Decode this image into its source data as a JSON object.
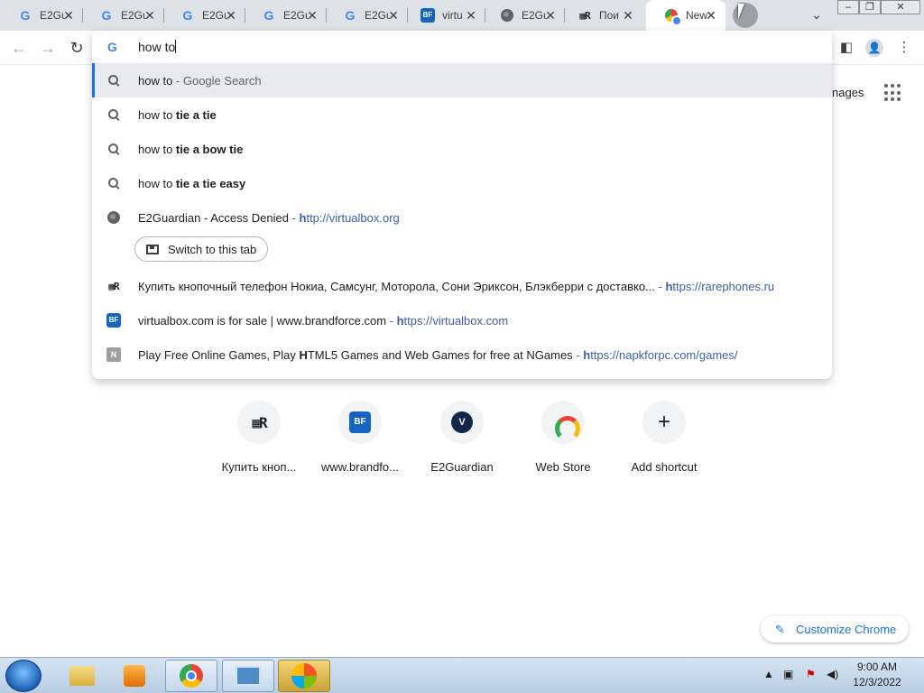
{
  "tabs": [
    {
      "title": "E2Gu",
      "favicon": "google-icon",
      "active": false
    },
    {
      "title": "E2Gu",
      "favicon": "google-icon",
      "active": false
    },
    {
      "title": "E2Gu",
      "favicon": "google-icon",
      "active": false
    },
    {
      "title": "E2Gu",
      "favicon": "google-icon",
      "active": false
    },
    {
      "title": "E2Gu",
      "favicon": "google-icon",
      "active": false
    },
    {
      "title": "virtu",
      "favicon": "brandforce-icon",
      "active": false
    },
    {
      "title": "E2Gu",
      "favicon": "globe-icon",
      "active": false
    },
    {
      "title": "Пои",
      "favicon": "rarephones-icon",
      "active": false
    },
    {
      "title": "New",
      "favicon": "chrome-icon",
      "active": true
    }
  ],
  "window_controls": {
    "minimize": "–",
    "restore": "❐",
    "close": "✕"
  },
  "omnibox": {
    "typed_text": "how to"
  },
  "suggestions": [
    {
      "icon": "search-icon",
      "plain": "how to",
      "bold": "",
      "suffix": " - Google Search"
    },
    {
      "icon": "search-icon",
      "plain": "how to ",
      "bold": "tie a tie",
      "suffix": ""
    },
    {
      "icon": "search-icon",
      "plain": "how to ",
      "bold": "tie a bow tie",
      "suffix": ""
    },
    {
      "icon": "search-icon",
      "plain": "how to ",
      "bold": "tie a tie easy",
      "suffix": ""
    }
  ],
  "history": [
    {
      "title": "E2Guardian - Access Denied",
      "url_bold": "h",
      "url_rest": "ttp://virtualbox.org"
    },
    {
      "title": "Купить кнопочный телефон Нокиа, Самсунг, Моторола, Сони Эриксон, Блэкберри с доставко...",
      "url_bold": "h",
      "url_rest": "ttps://rarephones.ru"
    },
    {
      "title": "virtualbox.com is for sale | www.brandforce.com",
      "url_bold": "h",
      "url_rest": "ttps://virtualbox.com"
    },
    {
      "title_pre": "Play Free Online Games, Play ",
      "title_bold": "H",
      "title_post": "TML5 Games and Web Games for free at NGames",
      "url_bold": "h",
      "url_rest": "ttps://napkforpc.com/games/"
    }
  ],
  "switch_tab_label": "Switch to this tab",
  "separator": " - ",
  "header": {
    "images_label": "nages"
  },
  "shortcuts": [
    {
      "label": "Купить кноп...",
      "icon": "rarephones-icon"
    },
    {
      "label": "www.brandfo...",
      "icon": "brandforce-icon"
    },
    {
      "label": "E2Guardian",
      "icon": "v-logo-icon"
    },
    {
      "label": "Web Store",
      "icon": "webstore-icon"
    },
    {
      "label": "Add shortcut",
      "icon": "plus-icon"
    }
  ],
  "customize_label": "Customize Chrome",
  "taskbar": {
    "time": "9:00 AM",
    "date": "12/3/2022"
  },
  "colors": {
    "accent": "#1a73e8",
    "url": "#3c60a9",
    "tabstrip": "#dee1e6"
  }
}
